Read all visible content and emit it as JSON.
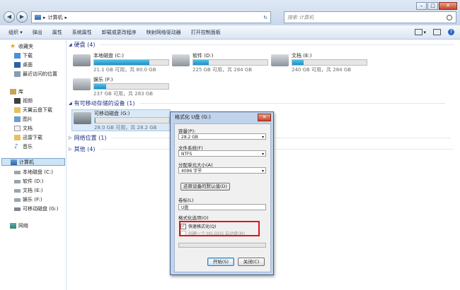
{
  "address": {
    "sep": "▸",
    "location": "计算机",
    "sep2": "▸",
    "refresh": "↻"
  },
  "search": {
    "placeholder": "搜索 计算机"
  },
  "window_controls": {
    "min": "–",
    "max": "□",
    "close": "✕"
  },
  "toolbar": {
    "items": [
      "组织 ▾",
      "弹出",
      "属性",
      "系统属性",
      "卸载或更改程序",
      "映射网络驱动器",
      "打开控制面板"
    ],
    "view_icon": "view-icon",
    "view_arrow": "▾",
    "help": "?"
  },
  "nav": {
    "favorites": {
      "title": "收藏夹",
      "items": [
        "下载",
        "桌面",
        "最近访问的位置"
      ]
    },
    "libraries": {
      "title": "库",
      "items": [
        "视频",
        "天翼云盘下载",
        "图片",
        "文档",
        "迅雷下载",
        "音乐"
      ]
    },
    "computer": {
      "title": "计算机",
      "items": [
        "本地磁盘 (C:)",
        "软件 (D:)",
        "文档 (E:)",
        "娱乐 (F:)",
        "可移动磁盘 (G:)"
      ]
    },
    "network": {
      "title": "网络"
    }
  },
  "groups": {
    "hdd": "硬盘 (4)",
    "removable": "有可移动存储的设备 (1)",
    "network": "网络位置 (1)",
    "other": "其他 (4)"
  },
  "drives": [
    {
      "name": "本地磁盘 (C:)",
      "size": "21.1 GB 可用，共 80.0 GB",
      "used_fraction": 0.74
    },
    {
      "name": "软件 (D:)",
      "size": "225 GB 可用，共 284 GB",
      "used_fraction": 0.21
    },
    {
      "name": "文档 (E:)",
      "size": "240 GB 可用，共 284 GB",
      "used_fraction": 0.15
    },
    {
      "name": "娱乐 (F:)",
      "size": "237 GB 可用，共 283 GB",
      "used_fraction": 0.16
    }
  ],
  "removable_drive": {
    "name": "可移动磁盘 (G:)",
    "size": "28.0 GB 可用，共 28.2 GB",
    "used_fraction": 0.01
  },
  "dialog": {
    "title": "格式化 U盘 (G:)",
    "close": "✕",
    "capacity_label": "容量(P):",
    "capacity_value": "28.2 GB",
    "fs_label": "文件系统(F)",
    "fs_value": "NTFS",
    "alloc_label": "分配单元大小(A)",
    "alloc_value": "4096 字节",
    "restore_button": "还原设备的默认值(D)",
    "volume_label": "卷标(L)",
    "volume_value": "U盘",
    "options_label": "格式化选项(O)",
    "quick_format": "快速格式化(Q)",
    "quick_format_checked": true,
    "msdos": "创建一个 MS-DOS 启动盘(M)",
    "msdos_checked": false,
    "start_button": "开始(S)",
    "close_button": "关闭(C)",
    "select_arrow": "▾"
  }
}
